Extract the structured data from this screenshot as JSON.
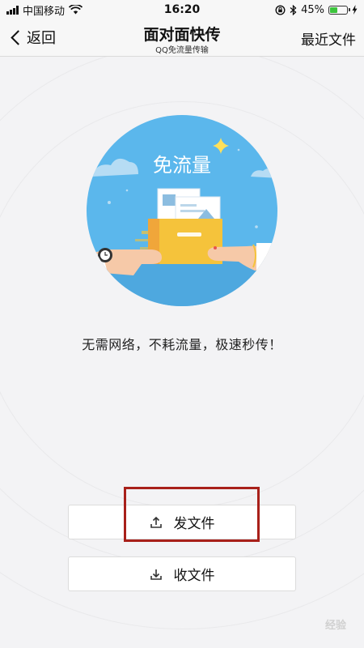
{
  "status_bar": {
    "carrier": "中国移动",
    "time": "16:20",
    "battery_percent": "45%",
    "battery_level": 0.45,
    "icons": [
      "signal-icon",
      "wifi-icon",
      "lock-rotation-icon",
      "bluetooth-icon",
      "battery-icon",
      "charging-icon"
    ]
  },
  "nav": {
    "back_label": "返回",
    "title": "面对面快传",
    "subtitle": "QQ免流量传输",
    "recent_label": "最近文件"
  },
  "illustration": {
    "badge_text": "免流量",
    "colors": {
      "sky": "#5bb7ec",
      "folder": "#f5c33b",
      "folder_dark": "#f0a63a"
    }
  },
  "tagline": "无需网络，不耗流量，极速秒传！",
  "actions": {
    "send_label": "发文件",
    "receive_label": "收文件"
  },
  "highlight_color": "#a8201a",
  "watermark": "经验"
}
